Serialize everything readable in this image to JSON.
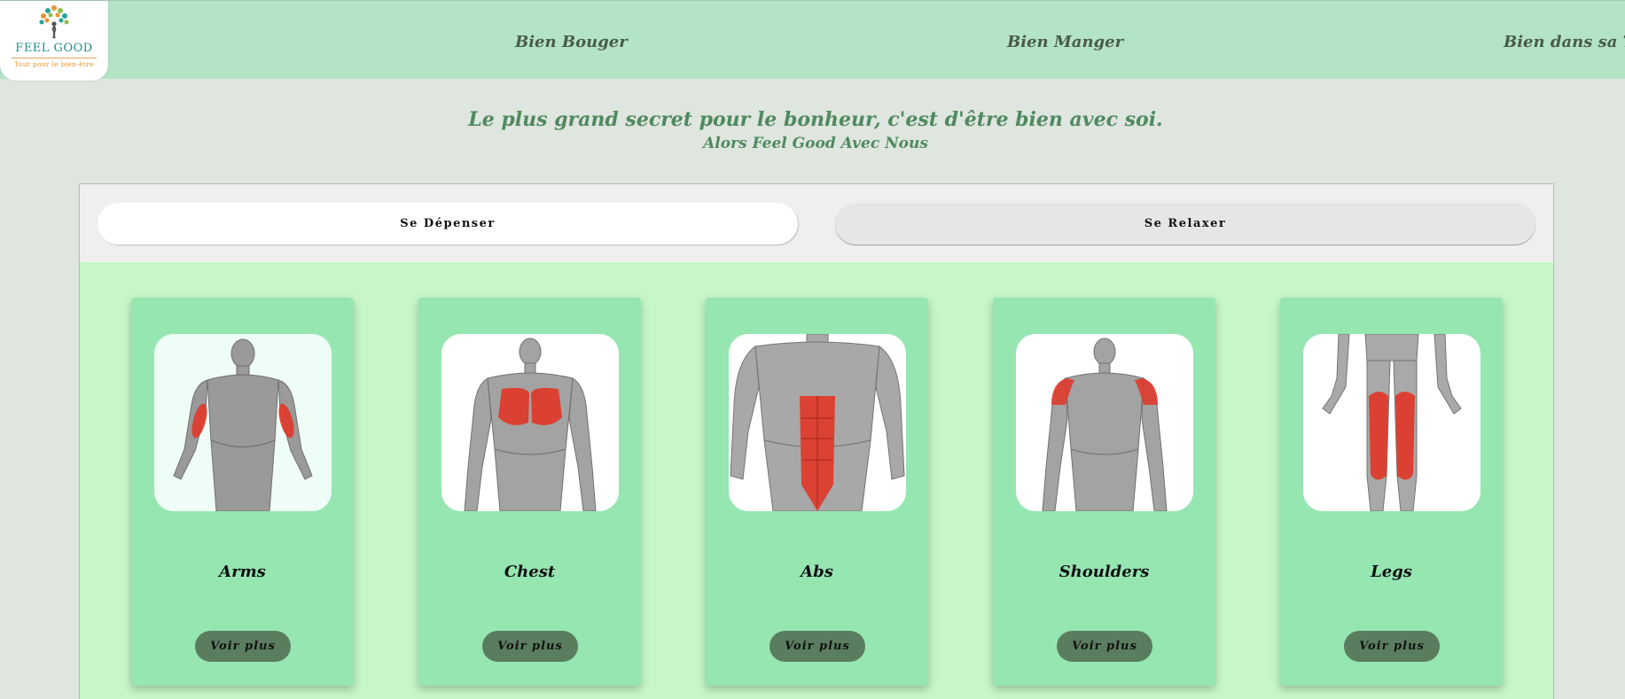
{
  "logo": {
    "name": "FEEL GOOD",
    "tagline": "Tout pour le bien-être"
  },
  "nav": {
    "items": [
      "Bien Bouger",
      "Bien Manger",
      "Bien dans sa Tête"
    ]
  },
  "hero": {
    "title": "Le plus grand secret pour le bonheur, c'est d'être bien avec soi.",
    "subtitle": "Alors Feel Good Avec Nous"
  },
  "tabs": {
    "active": "Se Dépenser",
    "inactive": "Se Relaxer"
  },
  "cards": [
    {
      "title": "Arms",
      "button": "Voir plus",
      "highlight": "arms"
    },
    {
      "title": "Chest",
      "button": "Voir plus",
      "highlight": "chest"
    },
    {
      "title": "Abs",
      "button": "Voir plus",
      "highlight": "abs"
    },
    {
      "title": "Shoulders",
      "button": "Voir plus",
      "highlight": "shoulders"
    },
    {
      "title": "Legs",
      "button": "Voir plus",
      "highlight": "legs"
    }
  ],
  "colors": {
    "header_bg": "#b3e4c5",
    "page_bg": "#dfe5df",
    "panel_bg": "#c7f7c9",
    "card_bg": "#96e6b2",
    "button_bg": "#5a7d5f",
    "muscle_red": "#e0392a",
    "hero_text": "#4f8a5e"
  }
}
